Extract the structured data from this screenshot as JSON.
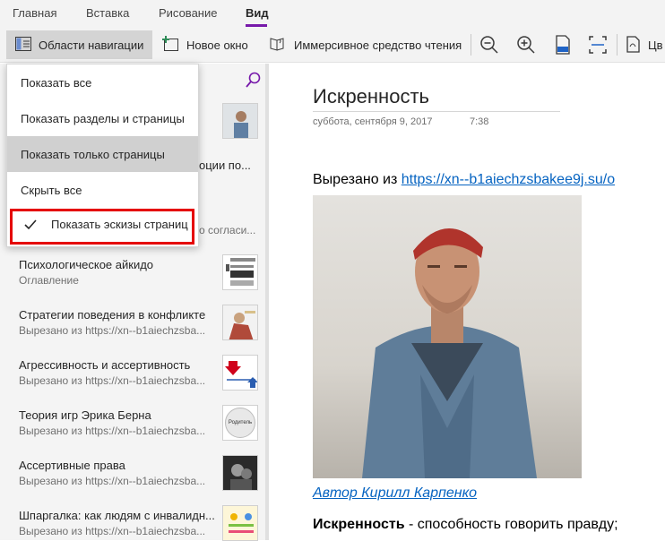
{
  "ribbon": {
    "tabs": [
      {
        "label": "Главная"
      },
      {
        "label": "Вставка"
      },
      {
        "label": "Рисование"
      },
      {
        "label": "Вид",
        "active": true
      }
    ],
    "accent_color": "#7719aa",
    "toolbar": {
      "nav_panes_label": "Области навигации",
      "new_window_label": "Новое окно",
      "immersive_reader_label": "Иммерсивное средство чтения",
      "truncated_label": "Цв"
    }
  },
  "dropdown": {
    "items": [
      {
        "label": "Показать все"
      },
      {
        "label": "Показать разделы и страницы"
      },
      {
        "label": "Показать только страницы",
        "highlighted": true
      },
      {
        "label": "Скрыть все"
      }
    ],
    "checkbox": {
      "label": "Показать эскизы страниц",
      "checked": true
    },
    "highlight_color": "#e50000"
  },
  "page_list": {
    "partial_items": [
      {
        "title": "оции по..."
      },
      {
        "subtitle": "о согласи..."
      }
    ],
    "items": [
      {
        "title": "Психологическое айкидо",
        "subtitle": "Оглавление"
      },
      {
        "title": "Стратегии поведения в конфликте",
        "subtitle": "Вырезано из https://xn--b1aiechzsba..."
      },
      {
        "title": "Агрессивность и ассертивность",
        "subtitle": "Вырезано из https://xn--b1aiechzsba..."
      },
      {
        "title": "Теория игр Эрика Берна",
        "subtitle": "Вырезано из https://xn--b1aiechzsba...",
        "thumb_text": "Родитель"
      },
      {
        "title": "Ассертивные права",
        "subtitle": "Вырезано из https://xn--b1aiechzsba..."
      },
      {
        "title": "Шпаргалка: как людям с инвалидн...",
        "subtitle": "Вырезано из https://xn--b1aiechzsba..."
      }
    ]
  },
  "note": {
    "title": "Искренность",
    "date": "суббота, сентября 9, 2017",
    "time": "7:38",
    "clipped_prefix": "Вырезано из ",
    "clipped_link": "https://xn--b1aiechzsbakee9j.su/o",
    "author_link": "Автор Кирилл Карпенко",
    "body_bold": "Искренность",
    "body_rest": " - способность говорить правду;"
  }
}
